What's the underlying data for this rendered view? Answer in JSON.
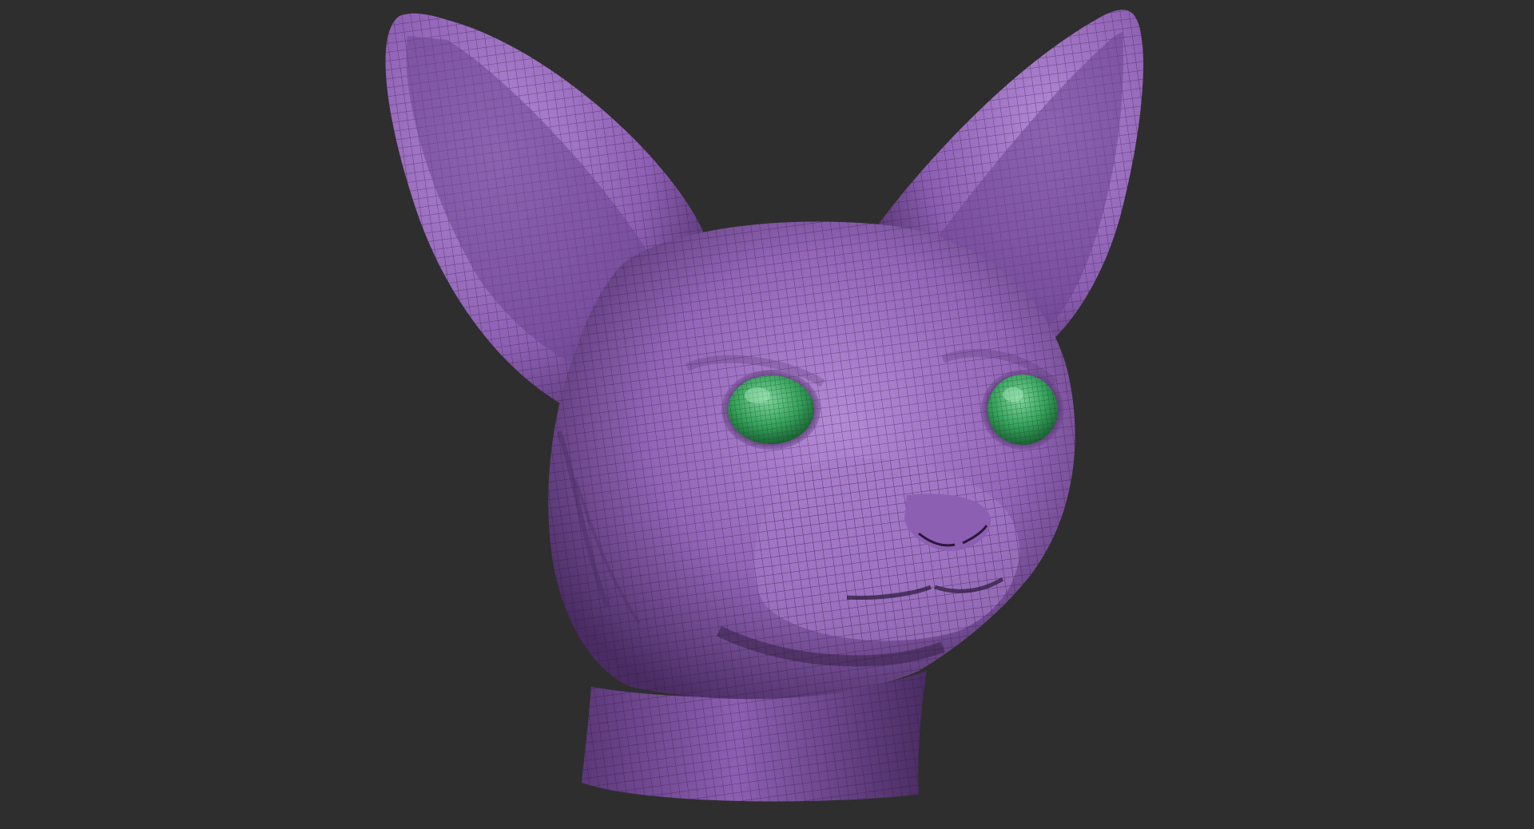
{
  "viewport": {
    "background_color": "#2e2e2e"
  },
  "model": {
    "subject": "sphynx-cat-head",
    "material_color": "#9365b8",
    "material_highlight": "#b48ad6",
    "material_shadow": "#4a2c63",
    "wire_color": "#2a1838",
    "eye_color": "#36a25c",
    "eye_highlight": "#7fd59b",
    "eye_shadow": "#16582d",
    "display_mode": "polyframe-wireframe"
  }
}
